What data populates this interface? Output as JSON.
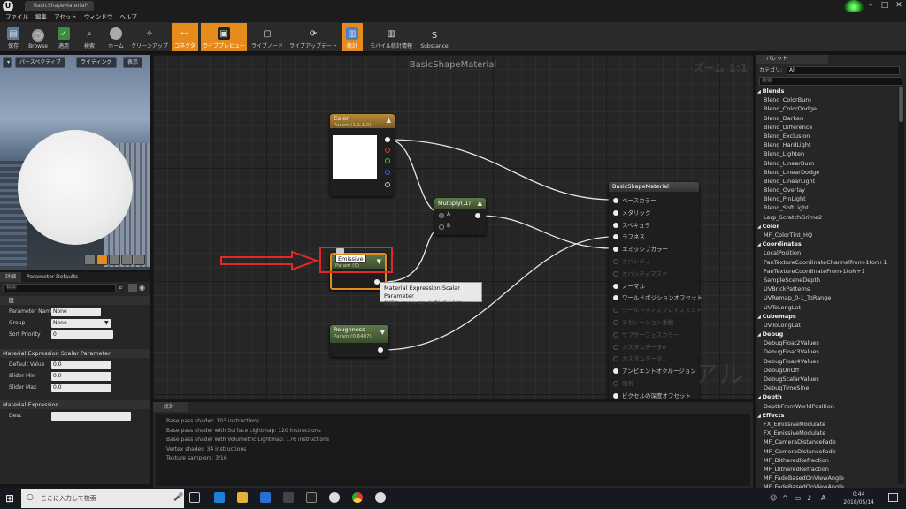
{
  "window": {
    "doc_tab": "BasicShapeMaterial*"
  },
  "menu": [
    "ファイル",
    "編集",
    "アセット",
    "ウィンドウ",
    "ヘルプ"
  ],
  "toolbar": [
    {
      "label": "保存",
      "active": false
    },
    {
      "label": "Browse",
      "active": false
    },
    {
      "label": "適用",
      "active": false
    },
    {
      "label": "検索",
      "active": false
    },
    {
      "label": "ホーム",
      "active": false
    },
    {
      "label": "クリーンアップ",
      "active": false
    },
    {
      "label": "コネクタ",
      "active": true
    },
    {
      "label": "ライブプレビュー",
      "active": true
    },
    {
      "label": "ライブノード",
      "active": false
    },
    {
      "label": "ライブアップデート",
      "active": false
    },
    {
      "label": "統計",
      "active": true
    },
    {
      "label": "モバイル統計情報",
      "active": false
    },
    {
      "label": "Substance",
      "active": false
    }
  ],
  "viewport": {
    "perspective": "パースペクティブ",
    "lighting": "ライティング",
    "show": "表示"
  },
  "details": {
    "tab_details": "詳細",
    "tab_params": "Parameter Defaults",
    "search_placeholder": "検索",
    "section_general": "一般",
    "param_name_label": "Parameter Name",
    "param_name_value": "None",
    "group_label": "Group",
    "group_value": "None",
    "sort_priority_label": "Sort Priority",
    "sort_priority_value": "0",
    "section_scalar": "Material Expression Scalar Parameter",
    "default_value_label": "Default Value",
    "default_value": "0.0",
    "slider_min_label": "Slider Min",
    "slider_min": "0.0",
    "slider_max_label": "Slider Max",
    "slider_max": "0.0",
    "section_expression": "Material Expression",
    "desc_label": "Desc"
  },
  "graph": {
    "title": "BasicShapeMaterial",
    "zoom": "ズーム 1:1",
    "watermark": "マテリアル",
    "color_node": {
      "title": "Color",
      "sub": "Param (1,1,1,0)"
    },
    "multiply_node": {
      "title": "Multiply(,1)",
      "pin_a": "A",
      "pin_b": "B"
    },
    "emissive_node": {
      "title": "Emissive",
      "sub": "Param (0)"
    },
    "roughness_node": {
      "title": "Roughness",
      "sub": "Param (0.6407)"
    },
    "material_node": {
      "title": "BasicShapeMaterial",
      "pins": [
        {
          "label": "ベースカラー",
          "enabled": true
        },
        {
          "label": "メタリック",
          "enabled": true
        },
        {
          "label": "スペキュラ",
          "enabled": true
        },
        {
          "label": "ラフネス",
          "enabled": true
        },
        {
          "label": "エミッシブカラー",
          "enabled": true
        },
        {
          "label": "オパシティ",
          "enabled": false
        },
        {
          "label": "オパシティマスク",
          "enabled": false
        },
        {
          "label": "ノーマル",
          "enabled": true
        },
        {
          "label": "ワールドポジションオフセット",
          "enabled": true
        },
        {
          "label": "ワールドディスプレイスメント",
          "enabled": false
        },
        {
          "label": "テセレーション乗数",
          "enabled": false
        },
        {
          "label": "サブサーフェスカラー",
          "enabled": false
        },
        {
          "label": "カスタムデータ0",
          "enabled": false
        },
        {
          "label": "カスタムデータ1",
          "enabled": false
        },
        {
          "label": "アンビエントオクルージョン",
          "enabled": true
        },
        {
          "label": "屈折",
          "enabled": false
        },
        {
          "label": "ピクセルの深度オフセット",
          "enabled": true
        }
      ]
    },
    "tooltip": {
      "title": "Material Expression Scalar Parameter",
      "hint": "詳細は (Ctrl + Alt) を押してください"
    }
  },
  "palette": {
    "tab": "パレット",
    "category_label": "カテゴリ:",
    "category_value": "All",
    "search_placeholder": "検索",
    "items": [
      {
        "t": "Blends",
        "c": true
      },
      {
        "t": "Blend_ColorBurn"
      },
      {
        "t": "Blend_ColorDodge"
      },
      {
        "t": "Blend_Darken"
      },
      {
        "t": "Blend_Difference"
      },
      {
        "t": "Blend_Exclusion"
      },
      {
        "t": "Blend_HardLight"
      },
      {
        "t": "Blend_Lighten"
      },
      {
        "t": "Blend_LinearBurn"
      },
      {
        "t": "Blend_LinearDodge"
      },
      {
        "t": "Blend_LinearLight"
      },
      {
        "t": "Blend_Overlay"
      },
      {
        "t": "Blend_PinLight"
      },
      {
        "t": "Blend_SoftLight"
      },
      {
        "t": "Lerp_ScratchGrime2"
      },
      {
        "t": "Color",
        "c": true
      },
      {
        "t": "MF_ColorTint_HQ"
      },
      {
        "t": "Coordinates",
        "c": true
      },
      {
        "t": "LocalPosition"
      },
      {
        "t": "PanTextureCoordinateChannelfrom-1ton+1"
      },
      {
        "t": "PanTextureCoordinateFrom-1toN+1"
      },
      {
        "t": "SampleSceneDepth"
      },
      {
        "t": "UVBrickPatterns"
      },
      {
        "t": "UVRemap_0-1_ToRange"
      },
      {
        "t": "UVToLongLat"
      },
      {
        "t": "Cubemaps",
        "c": true
      },
      {
        "t": "UVToLongLat"
      },
      {
        "t": "Debug",
        "c": true
      },
      {
        "t": "DebugFloat2Values"
      },
      {
        "t": "DebugFloat3Values"
      },
      {
        "t": "DebugFloat4Values"
      },
      {
        "t": "DebugOnOff"
      },
      {
        "t": "DebugScalarValues"
      },
      {
        "t": "DebugTimeSine"
      },
      {
        "t": "Depth",
        "c": true
      },
      {
        "t": "DepthFromWorldPosition"
      },
      {
        "t": "Effects",
        "c": true
      },
      {
        "t": "FX_EmissiveModulate"
      },
      {
        "t": "FX_EmissiveModulate"
      },
      {
        "t": "MF_CameraDistanceFade"
      },
      {
        "t": "MF_CameraDistanceFade"
      },
      {
        "t": "MF_DitheredRefraction"
      },
      {
        "t": "MF_DitheredRefraction"
      },
      {
        "t": "MF_FadeBasedOnViewAngle"
      },
      {
        "t": "MF_FadeBasedOnViewAngle"
      }
    ]
  },
  "stats": {
    "tab": "統計",
    "lines": [
      "Base pass shader: 103 instructions",
      "Base pass shader with Surface Lightmap: 120 instructions",
      "Base pass shader with Volumetric Lightmap: 176 instructions",
      "Vertex shader: 34 instructions",
      "Texture samplers: 3/16"
    ]
  },
  "taskbar": {
    "search_placeholder": "ここに入力して検索",
    "time": "0:44",
    "date": "2018/05/14",
    "ime": "A"
  }
}
